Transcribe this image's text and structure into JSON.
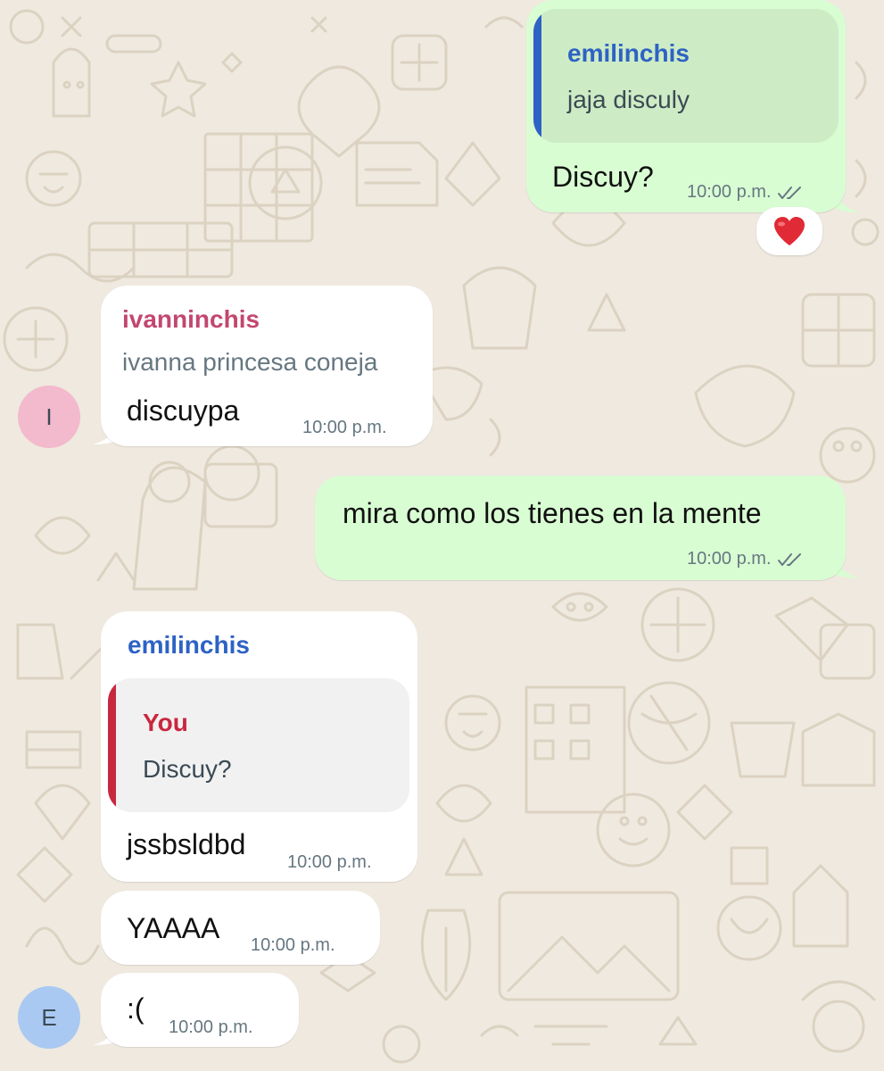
{
  "colors": {
    "wallpaper": "#efe9df",
    "outgoing_bubble": "#d9fdd3",
    "incoming_bubble": "#ffffff",
    "emilinchis_name": "#2e62c4",
    "ivanninchis_name": "#c2476f",
    "you_name": "#c8283f",
    "read_ticks": "#667781",
    "heart": "#e02a35"
  },
  "messages": [
    {
      "direction": "outgoing",
      "quote": {
        "author": "emilinchis",
        "text": "jaja disculy"
      },
      "text": "Discuy?",
      "time": "10:00 p.m.",
      "status_icon": "double-check-icon",
      "reaction": "heart-emoji"
    },
    {
      "direction": "incoming",
      "sender": "ivanninchis",
      "subtitle": "ivanna princesa coneja",
      "text": "discuypa",
      "time": "10:00 p.m.",
      "avatar": "I"
    },
    {
      "direction": "outgoing",
      "text": "mira como los tienes en la mente",
      "time": "10:00 p.m.",
      "status_icon": "double-check-icon"
    },
    {
      "direction": "incoming",
      "sender": "emilinchis",
      "quote": {
        "author": "You",
        "text": "Discuy?"
      },
      "text": "jssbsldbd",
      "time": "10:00 p.m."
    },
    {
      "direction": "incoming",
      "text": "YAAAA",
      "time": "10:00 p.m."
    },
    {
      "direction": "incoming",
      "text": ":(",
      "time": "10:00 p.m.",
      "avatar": "E"
    }
  ]
}
